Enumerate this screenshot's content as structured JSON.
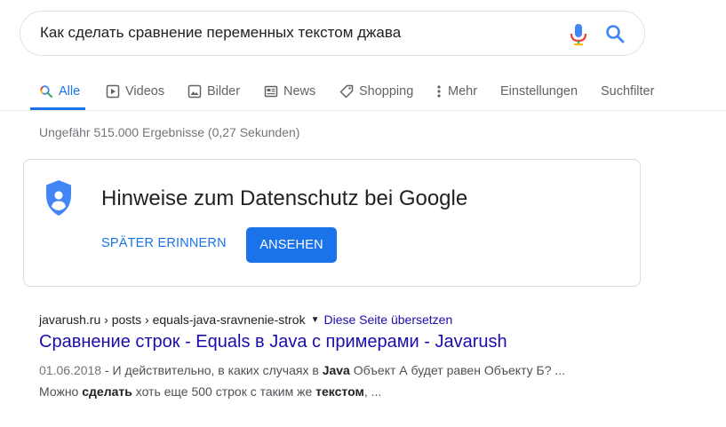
{
  "search": {
    "query": "Как сделать сравнение переменных текстом джава",
    "mic_icon": "microphone-icon",
    "search_icon": "magnifier-icon"
  },
  "tabs": [
    {
      "label": "Alle",
      "icon": "search-icon",
      "active": true
    },
    {
      "label": "Videos",
      "icon": "video-play-icon"
    },
    {
      "label": "Bilder",
      "icon": "image-icon"
    },
    {
      "label": "News",
      "icon": "news-icon"
    },
    {
      "label": "Shopping",
      "icon": "tag-icon"
    },
    {
      "label": "Mehr",
      "icon": "more-vert-icon"
    },
    {
      "label": "Einstellungen"
    },
    {
      "label": "Suchfilter"
    }
  ],
  "stats": "Ungefähr 515.000 Ergebnisse (0,27 Sekunden)",
  "privacy_card": {
    "title": "Hinweise zum Datenschutz bei Google",
    "later_label": "SPÄTER ERINNERN",
    "view_label": "ANSEHEN",
    "icon": "shield-user-icon"
  },
  "result": {
    "cite": "javarush.ru › posts › equals-java-sravnenie-strok",
    "translate_label": "Diese Seite übersetzen",
    "title": "Сравнение строк - Equals в Java с примерами - Javarush",
    "date": "01.06.2018",
    "snippet_line1_a": " - И действительно, в каких случаях в ",
    "snippet_line1_bold": "Java",
    "snippet_line1_b": " Объект А будет равен Объекту Б? ...",
    "snippet_line2_a": "Можно ",
    "snippet_line2_bold1": "сделать",
    "snippet_line2_b": " хоть еще 500 строк с таким же ",
    "snippet_line2_bold2": "текстом",
    "snippet_line2_c": ", ..."
  },
  "colors": {
    "accent": "#1a73e8",
    "link": "#1a0dab",
    "secondary_text": "#70757a"
  }
}
